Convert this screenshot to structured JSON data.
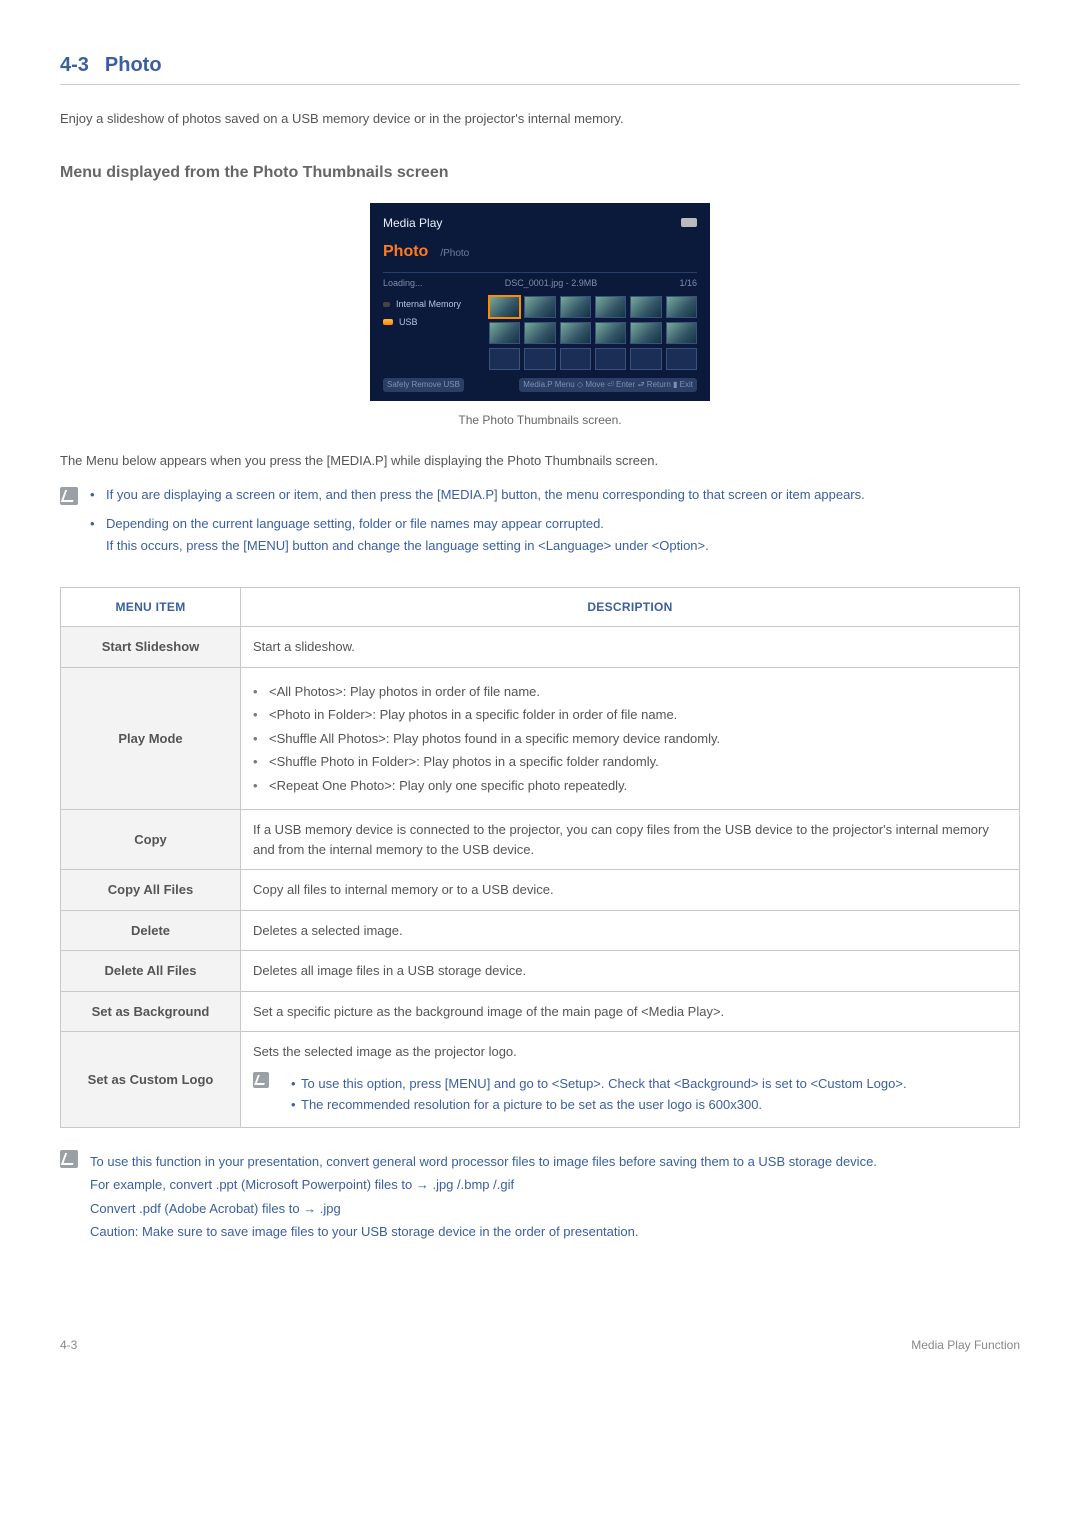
{
  "section": {
    "number": "4-3",
    "title": "Photo"
  },
  "intro": "Enjoy a slideshow of photos saved on a USB memory device or in the projector's internal memory.",
  "subheading": "Menu displayed from the Photo Thumbnails screen",
  "screenshot": {
    "app_title": "Media Play",
    "tab_title": "Photo",
    "breadcrumb": "/Photo",
    "loading_label": "Loading...",
    "current_file": "DSC_0001.jpg - 2.9MB",
    "page_indicator": "1/16",
    "sidebar": {
      "internal": "Internal Memory",
      "usb": "USB"
    },
    "footer_left": "Safely Remove USB",
    "footer_right": "Media.P Menu  ◇ Move  ⏎ Enter  ⮐ Return  ▮ Exit"
  },
  "caption": "The Photo Thumbnails screen.",
  "menu_press_text": "The Menu below appears when you press the [MEDIA.P] while displaying the Photo Thumbnails screen.",
  "notes": {
    "item1": "If you are displaying a screen or item, and then press the [MEDIA.P] button, the menu corresponding to that screen or item appears.",
    "item2a": "Depending on the current language setting, folder or file names may appear corrupted.",
    "item2b": "If this occurs, press the [MENU] button and change the language setting in <Language> under <Option>."
  },
  "table": {
    "head_menu": "MENU ITEM",
    "head_desc": "DESCRIPTION",
    "rows": {
      "start_slideshow": {
        "label": "Start Slideshow",
        "desc": "Start a slideshow."
      },
      "play_mode": {
        "label": "Play Mode",
        "b1": "<All Photos>: Play photos in order of file name.",
        "b2": "<Photo in Folder>: Play photos in a specific folder in order of file name.",
        "b3": "<Shuffle All Photos>: Play photos found in a specific memory device randomly.",
        "b4": "<Shuffle Photo in Folder>: Play photos in a specific folder randomly.",
        "b5": "<Repeat One Photo>: Play only one specific photo repeatedly."
      },
      "copy": {
        "label": "Copy",
        "desc": "If a USB memory device is connected to the projector, you can copy files from the USB device to the projector's internal memory and from the internal memory to the USB device."
      },
      "copy_all": {
        "label": "Copy All Files",
        "desc": "Copy all files to internal memory or to a USB device."
      },
      "delete": {
        "label": "Delete",
        "desc": "Deletes a selected image."
      },
      "delete_all": {
        "label": "Delete All Files",
        "desc": "Deletes all image files in a USB storage device."
      },
      "set_bg": {
        "label": "Set as Background",
        "desc": "Set a specific picture as the background image of the main page of <Media Play>."
      },
      "set_logo": {
        "label": "Set as Custom Logo",
        "desc": "Sets the selected image as the projector logo.",
        "note1": "To use this option, press [MENU] and go to <Setup>. Check that <Background> is set to <Custom Logo>.",
        "note2": "The recommended resolution for a picture to be set as the user logo is 600x300."
      }
    }
  },
  "bottom_note": {
    "l1": "To use this function in your presentation, convert general word processor files to image files before saving them to a USB storage device.",
    "l2": "For example, convert .ppt (Microsoft Powerpoint) files to → .jpg /.bmp /.gif",
    "l3": "Convert .pdf (Adobe Acrobat) files to → .jpg",
    "l4": "Caution: Make sure to save image files to your USB storage device in the order of presentation."
  },
  "footer": {
    "left": "4-3",
    "right": "Media Play Function"
  }
}
